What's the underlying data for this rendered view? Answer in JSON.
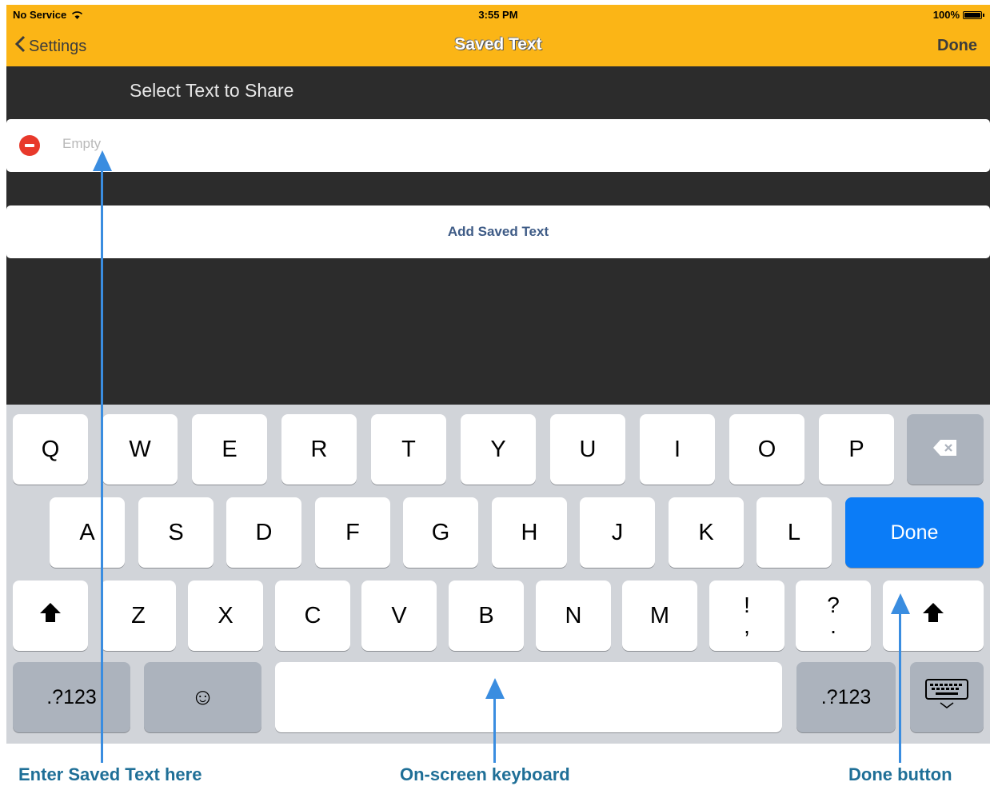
{
  "status_bar": {
    "carrier": "No Service",
    "wifi_icon": "wifi-icon",
    "time": "3:55 PM",
    "battery": "100%"
  },
  "nav": {
    "back_label": "Settings",
    "title": "Saved Text",
    "done_label": "Done"
  },
  "list": {
    "section_header": "Select Text to Share",
    "empty_placeholder": "Empty",
    "add_label": "Add Saved Text"
  },
  "keyboard": {
    "row1": [
      "Q",
      "W",
      "E",
      "R",
      "T",
      "Y",
      "U",
      "I",
      "O",
      "P"
    ],
    "row2": [
      "A",
      "S",
      "D",
      "F",
      "G",
      "H",
      "J",
      "K",
      "L"
    ],
    "row3": [
      "Z",
      "X",
      "C",
      "V",
      "B",
      "N",
      "M"
    ],
    "punct1": [
      "!",
      ","
    ],
    "punct2": [
      "?",
      "."
    ],
    "done": "Done",
    "numbers": ".?123",
    "emoji": "☺",
    "shift": "⬆"
  },
  "annotations": {
    "enter_text": "Enter Saved Text here",
    "keyboard": "On-screen keyboard",
    "done": "Done button"
  },
  "colors": {
    "accent": "#fbb516",
    "done_key": "#0b7cf7",
    "annotation": "#1f6f97",
    "arrow": "#3a8de0"
  }
}
